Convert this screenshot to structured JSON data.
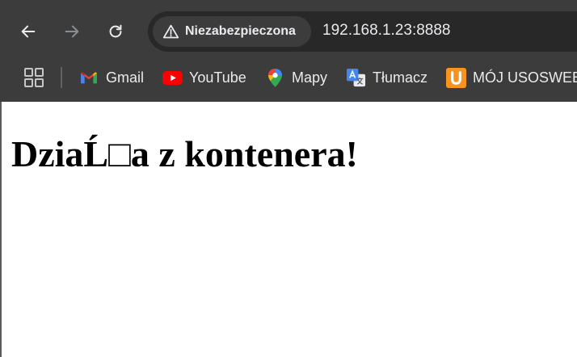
{
  "browser": {
    "security_label": "Niezabezpieczona",
    "url": "192.168.1.23:8888",
    "icons": {
      "back": "arrow-left-icon",
      "forward": "arrow-right-icon",
      "reload": "reload-icon",
      "security": "warning-triangle-icon",
      "apps": "apps-grid-icon"
    }
  },
  "bookmarks": [
    {
      "label": "Gmail",
      "icon": "gmail-icon"
    },
    {
      "label": "YouTube",
      "icon": "youtube-icon"
    },
    {
      "label": "Mapy",
      "icon": "maps-pin-icon"
    },
    {
      "label": "Tłumacz",
      "icon": "translate-icon"
    },
    {
      "label": "MÓJ USOSWEB",
      "icon": "usosweb-icon"
    }
  ],
  "page": {
    "heading": "DziaĹ□a z kontenera!"
  },
  "colors": {
    "toolbar": "#3c3c3c",
    "omnibox": "#282828",
    "text": "#e8eaed",
    "page_background": "#ffffff"
  }
}
